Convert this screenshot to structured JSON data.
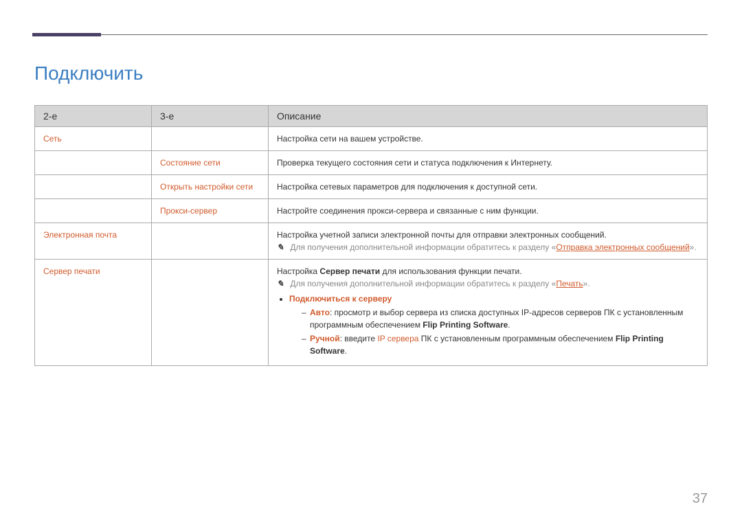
{
  "title": "Подключить",
  "headers": {
    "c1": "2-е",
    "c2": "3-е",
    "c3": "Описание"
  },
  "rows": {
    "network": {
      "label": "Сеть",
      "desc": "Настройка сети на вашем устройстве."
    },
    "status": {
      "label": "Состояние сети",
      "desc": "Проверка текущего состояния сети и статуса подключения к Интернету."
    },
    "open": {
      "label": "Открыть настройки сети",
      "desc": "Настройка сетевых параметров для подключения к доступной сети."
    },
    "proxy": {
      "label": "Прокси-сервер",
      "desc": "Настройте соединения прокси-сервера и связанные с ним функции."
    },
    "email": {
      "label": "Электронная почта",
      "desc": "Настройка учетной записи электронной почты для отправки электронных сообщений.",
      "note_prefix": "Для получения дополнительной информации обратитесь к разделу «",
      "note_link": "Отправка электронных сообщений",
      "note_suffix": "»."
    },
    "printserver": {
      "label": "Сервер печати",
      "desc_prefix": "Настройка ",
      "desc_bold": "Сервер печати",
      "desc_suffix": " для использования функции печати.",
      "note_prefix": "Для получения дополнительной информации обратитесь к разделу «",
      "note_link": "Печать",
      "note_suffix": "».",
      "connect_label": "Подключиться к серверу",
      "auto": {
        "label": "Авто",
        "text1": ": просмотр и выбор сервера из списка доступных IP-адресов серверов ПК с установленным программным обеспечением ",
        "bold": "Flip Printing Software",
        "text2": "."
      },
      "manual": {
        "label": "Ручной",
        "text1": ": введите ",
        "ip": "IP сервера",
        "text2": " ПК с установленным программным обеспечением ",
        "bold": "Flip Printing Software",
        "text3": "."
      }
    }
  },
  "page_number": "37"
}
